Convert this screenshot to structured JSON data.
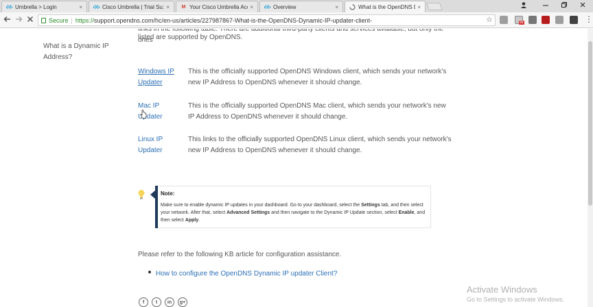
{
  "browser": {
    "tabs": [
      {
        "label": "Umbrella > Login",
        "favicon": "cisco-icon",
        "active": false
      },
      {
        "label": "Cisco Umbrella | Trial Su:",
        "favicon": "cisco-icon",
        "active": false
      },
      {
        "label": "Your Cisco Umbrella Acc",
        "favicon": "gmail-icon",
        "active": false
      },
      {
        "label": "Overview",
        "favicon": "cisco-icon",
        "active": false
      },
      {
        "label": "What is the OpenDNS D",
        "favicon": "loading-icon",
        "active": true
      }
    ],
    "tab_close_glyph": "×",
    "secure_label": "Secure",
    "url_scheme": "https://",
    "url_rest": "support.opendns.com/hc/en-us/articles/227987867-What-is-the-OpenDNS-Dynamic-IP-updater-client-",
    "extension_badge": "99"
  },
  "page": {
    "sidebar_link": "What is a Dynamic IP Address?",
    "cut_text": "links in the following table. There are additional third-party clients and services available, but only the ones",
    "intro_tail": "listed are supported by OpenDNS.",
    "clients": [
      {
        "link": "Windows IP Updater",
        "description": "This is the officially supported OpenDNS Windows client, which sends your network's new IP Address to OpenDNS whenever it should change."
      },
      {
        "link": "Mac IP Updater",
        "description": "This is the officially supported OpenDNS Mac client, which sends your network's new IP Address to OpenDNS whenever it should change."
      },
      {
        "link": "Linux IP Updater",
        "description": "This links to the officially supported OpenDNS Linux client, which sends your network's new IP Address to OpenDNS whenever it should change."
      }
    ],
    "note": {
      "title": "Note:",
      "body_1": "Make sure to enable dynamic IP updates in your dashboard. Go to your dashboard, select the ",
      "body_settings": "Settings",
      "body_2": " tab, and then select your network. After that, select ",
      "body_advanced": "Advanced Settings",
      "body_3": " and then navigate to the Dynamic IP Update section, select ",
      "body_enable": "Enable",
      "body_4": ", and then select ",
      "body_apply": "Apply",
      "body_5": "."
    },
    "kb_intro": "Please refer to the following KB article for configuration assistance.",
    "kb_link": "How to configure the OpenDNS Dynamic IP updater Client?",
    "social": [
      "f",
      "t",
      "in",
      "g+"
    ]
  },
  "watermark": {
    "title": "Activate Windows",
    "subtitle": "Go to Settings to activate Windows."
  },
  "colors": {
    "link": "#2a6db5",
    "secure": "#2a8a2a",
    "note_bar": "#1f3a5a"
  }
}
